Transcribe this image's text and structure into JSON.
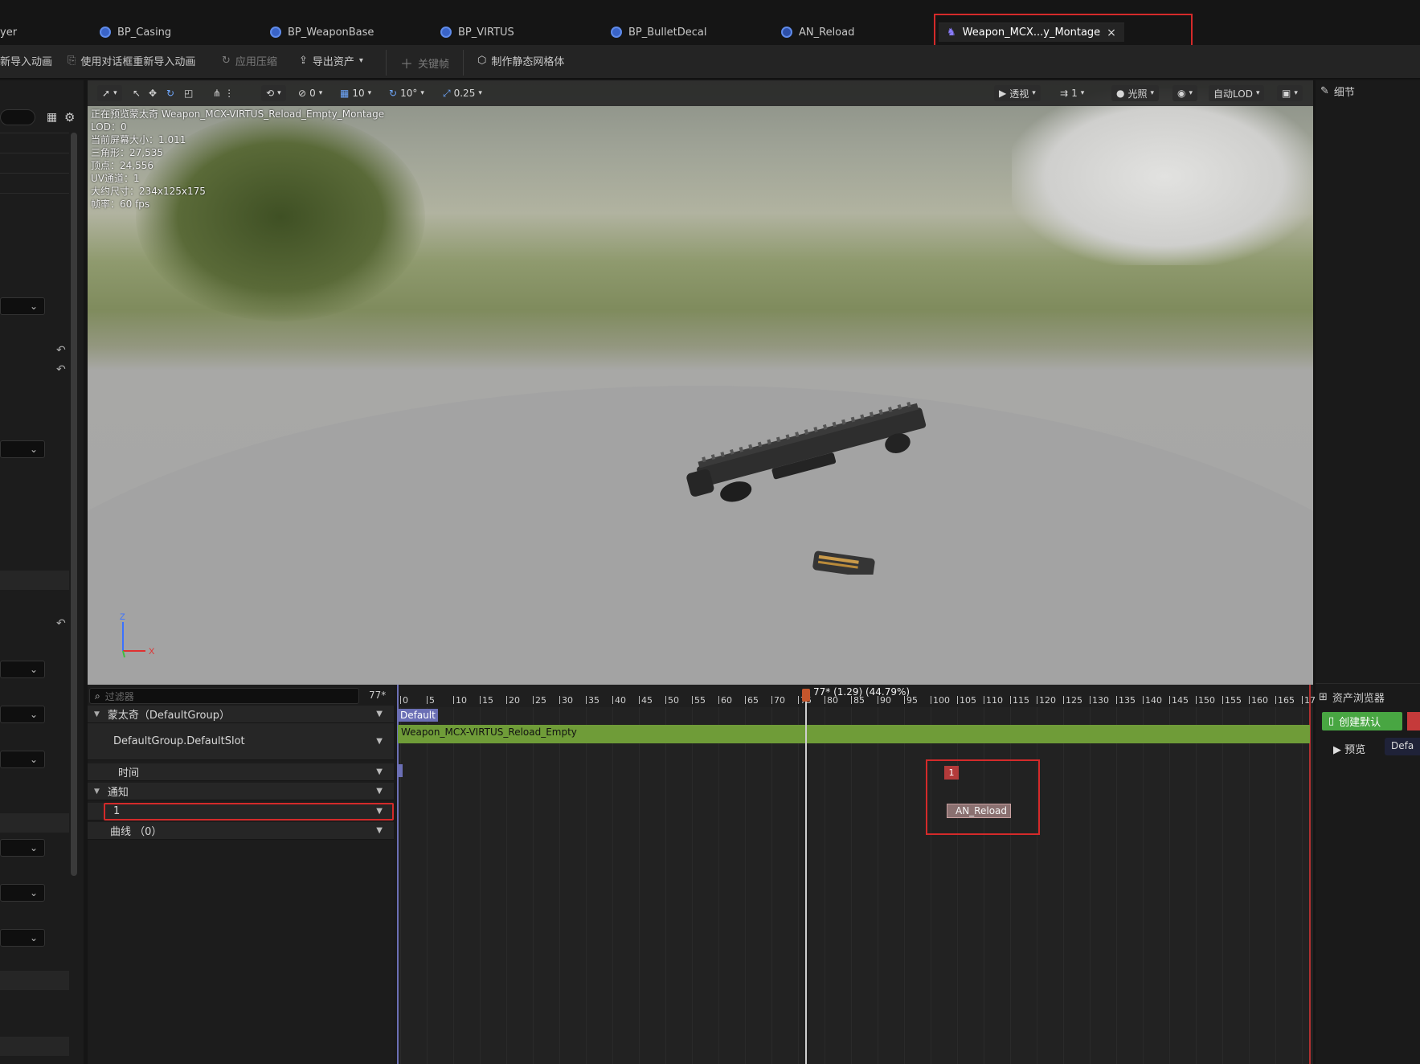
{
  "tabs": [
    {
      "label": "yer"
    },
    {
      "label": "BP_Casing"
    },
    {
      "label": "BP_WeaponBase"
    },
    {
      "label": "BP_VIRTUS"
    },
    {
      "label": "BP_BulletDecal"
    },
    {
      "label": "AN_Reload"
    },
    {
      "label": "Weapon_MCX...y_Montage",
      "close": "×"
    }
  ],
  "toolbar": {
    "reimport": "新导入动画",
    "reimport_dialog": "使用对话框重新导入动画",
    "apply_compression": "应用压缩",
    "export_asset": "导出资产",
    "key": "关键帧",
    "make_static_mesh": "制作静态网格体"
  },
  "viewport_toolbar": {
    "rot_val": "0",
    "grid_val": "10",
    "angle_val": "10°",
    "scale_val": "0.25",
    "perspective": "透视",
    "speed": "1",
    "lit": "光照",
    "lod": "自动LOD"
  },
  "stats": [
    "正在预览蒙太奇 Weapon_MCX-VIRTUS_Reload_Empty_Montage",
    "LOD：0",
    "当前屏幕大小：1.011",
    "三角形：27,535",
    "顶点：24,556",
    "UV通道：1",
    "大约尺寸：234x125x175",
    "帧率：60 fps"
  ],
  "axis": {
    "z": "Z",
    "x": "X"
  },
  "sequencer": {
    "filter_placeholder": "过滤器",
    "frame_count": "77*",
    "montage_group": "蒙太奇（DefaultGroup）",
    "slot": "DefaultGroup.DefaultSlot",
    "time": "时间",
    "notifies": "通知",
    "notify_track": "1",
    "curves": "曲线 （0）",
    "playhead": "77* (1.29) (44.79%)",
    "section": "Default",
    "anim_segment": "Weapon_MCX-VIRTUS_Reload_Empty",
    "notify_index": "1",
    "notify_name": "AN_Reload",
    "ticks": [
      "0",
      "5",
      "10",
      "15",
      "20",
      "25",
      "30",
      "35",
      "40",
      "45",
      "50",
      "55",
      "60",
      "65",
      "70",
      "75",
      "80",
      "85",
      "90",
      "95",
      "100",
      "105",
      "110",
      "115",
      "120",
      "125",
      "130",
      "135",
      "140",
      "145",
      "150",
      "155",
      "160",
      "165",
      "17"
    ]
  },
  "right_panel": {
    "details": "细节",
    "asset_browser": "资产浏览器",
    "create_default": "创建默认",
    "preview": "预览",
    "default": "Defa"
  },
  "colors": {
    "highlight": "#d42a2a",
    "anim_segment": "#6f9c38",
    "section": "#6b6fb5",
    "playhead": "#c4562c",
    "create_button": "#48a642"
  }
}
